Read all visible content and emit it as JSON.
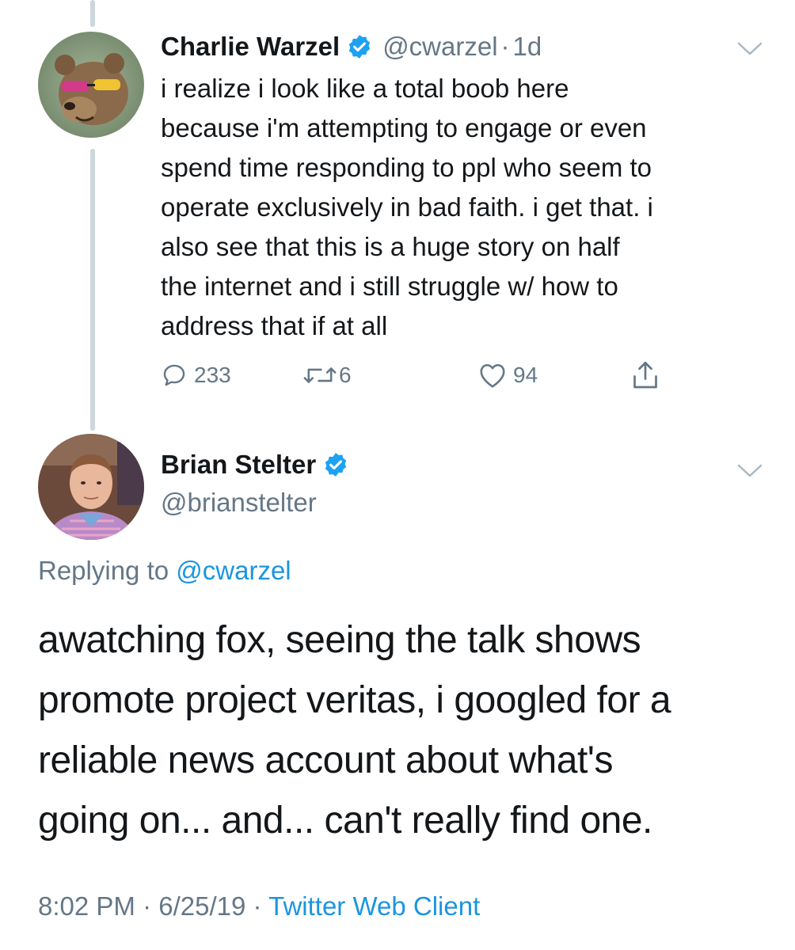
{
  "colors": {
    "text": "#14171a",
    "secondary": "#657786",
    "link": "#1b95e0",
    "verified": "#1da1f2",
    "thread_line": "#ccd6dd"
  },
  "tweet1": {
    "display_name": "Charlie Warzel",
    "handle": "@cwarzel",
    "separator": "·",
    "time": "1d",
    "text": "i realize i look like a total boob here\nbecause i'm attempting to engage or even\nspend time responding to ppl who seem to\noperate exclusively in bad faith. i get that. i\nalso see that this is a huge story on half\nthe internet and i still struggle w/ how to\naddress that if at all",
    "replies": "233",
    "retweets": "6",
    "likes": "94",
    "icons": [
      "verified-badge-icon",
      "chevron-down-icon",
      "reply-icon",
      "retweet-icon",
      "like-icon",
      "share-icon"
    ]
  },
  "tweet2": {
    "display_name": "Brian Stelter",
    "handle": "@brianstelter",
    "replying_prefix": "Replying to",
    "replying_to": "@cwarzel",
    "text": "awatching fox, seeing the talk shows\npromote project veritas, i googled for a\nreliable news account about what's\ngoing on... and... can't really find one.",
    "time": "8:02 PM",
    "date": "6/25/19",
    "separator": "·",
    "client": "Twitter Web Client",
    "icons": [
      "verified-badge-icon",
      "chevron-down-icon"
    ]
  }
}
